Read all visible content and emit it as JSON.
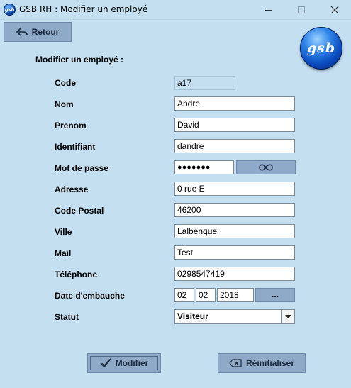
{
  "window": {
    "title": "GSB RH : Modifier un employé",
    "app_icon_text": "gsb"
  },
  "toolbar": {
    "back_label": "Retour"
  },
  "logo": {
    "text": "gsb"
  },
  "form": {
    "section_title": "Modifier un employé :",
    "labels": {
      "code": "Code",
      "nom": "Nom",
      "prenom": "Prenom",
      "identifiant": "Identifiant",
      "mot_de_passe": "Mot de passe",
      "adresse": "Adresse",
      "code_postal": "Code Postal",
      "ville": "Ville",
      "mail": "Mail",
      "telephone": "Téléphone",
      "date_embauche": "Date d'embauche",
      "statut": "Statut"
    },
    "values": {
      "code": "a17",
      "nom": "Andre",
      "prenom": "David",
      "identifiant": "dandre",
      "mot_de_passe": "●●●●●●●",
      "adresse": "0 rue E",
      "code_postal": "46200",
      "ville": "Lalbenque",
      "mail": "Test",
      "telephone": "0298547419",
      "date_day": "02",
      "date_month": "02",
      "date_year": "2018",
      "statut": "Visiteur"
    },
    "date_picker_label": "...",
    "statut_options": [
      "Visiteur"
    ]
  },
  "actions": {
    "modify_label": "Modifier",
    "reset_label": "Réinitialiser"
  },
  "colors": {
    "background": "#c4dff0",
    "button": "#8fa9c9",
    "logo_blue": "#0a4bbd"
  },
  "icons": {
    "back": "back-arrow-icon",
    "show_password": "infinity-eye-icon",
    "modify": "checkmark-icon",
    "reset": "clear-icon",
    "dropdown": "chevron-down-icon"
  }
}
